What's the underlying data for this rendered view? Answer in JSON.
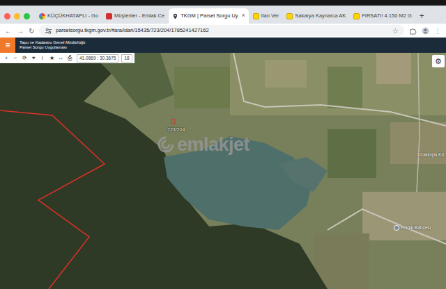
{
  "browser": {
    "tabs": [
      {
        "label": "KÜÇÜKHATAPLI - Go",
        "kind": "google",
        "selected": false
      },
      {
        "label": "Müşteriler - Emlak Ce",
        "kind": "emlakcepte",
        "selected": false
      },
      {
        "label": "TKGM | Parsel Sorgu Uy",
        "kind": "tkgm",
        "selected": true
      },
      {
        "label": "İlan Ver",
        "kind": "sahibinden",
        "selected": false
      },
      {
        "label": "Sakarya Kaynarca AK",
        "kind": "sahibinden",
        "selected": false
      },
      {
        "label": "FIRSATI! 4.150 M2 G",
        "kind": "sahibinden",
        "selected": false
      }
    ],
    "tab_close": "×",
    "new_tab": "+",
    "nav": [
      "←",
      "→",
      "↻"
    ],
    "url": "parselsorgu.tkgm.gov.tr/#ara/idari/15435/723/204/1785241427162",
    "bookmark": "☆",
    "menu": "⋮"
  },
  "app": {
    "menu": "≡",
    "org": "Tapu ve Kadastro Genel Müdürlüğü",
    "title": "Parsel Sorgu Uygulaması"
  },
  "toolbar": {
    "buttons": [
      "+",
      "−",
      "⟳",
      "⌖",
      "i",
      "★",
      "↔",
      "⎙"
    ],
    "coords": "41.0869 : 30.3675",
    "zoom": "18"
  },
  "map": {
    "settings": "⚙",
    "parcel_label": "723/204",
    "watermark": "emlakjet",
    "labels": [
      {
        "text": "Fındık Bahçesi"
      },
      {
        "text": "Uzakkışla Kö"
      }
    ]
  }
}
